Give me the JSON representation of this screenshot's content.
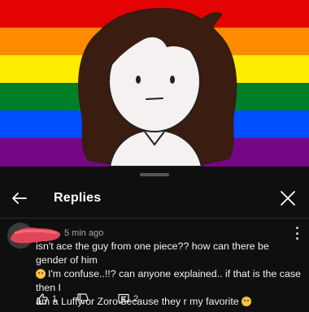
{
  "video": {
    "flag_colors": [
      "#e40303",
      "#ff8c00",
      "#ffed00",
      "#008026",
      "#004dff",
      "#750787"
    ]
  },
  "sheet": {
    "title": "Replies",
    "back_icon": "arrow-left-icon",
    "close_icon": "close-icon"
  },
  "comment": {
    "timestamp": "5 min ago",
    "line1": "isn't ace the guy from one piece?? how can there be gender of him",
    "line2": "I'm confuse..!!? can anyone explained.. if that is the case then I",
    "line3": "am a Luffy or Zoro because they r my favorite",
    "likes": "1",
    "replies": "2"
  }
}
